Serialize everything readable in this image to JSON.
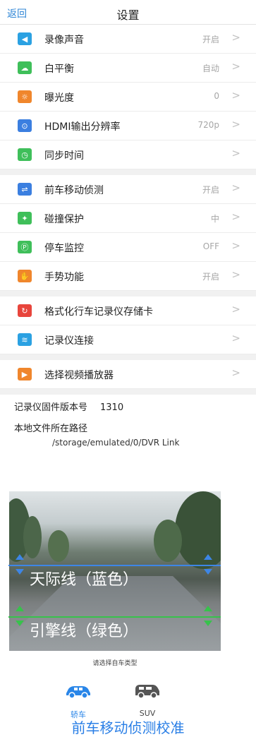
{
  "header": {
    "back_label": "返回",
    "title": "设置"
  },
  "settings": [
    {
      "label": "录像声音",
      "value": "开启",
      "icon": "speaker-icon",
      "color": "#2ba1e2"
    },
    {
      "label": "白平衡",
      "value": "自动",
      "icon": "white-balance-icon",
      "color": "#3fbf5a"
    },
    {
      "label": "曝光度",
      "value": "0",
      "icon": "exposure-icon",
      "color": "#f0862c"
    },
    {
      "label": "HDMI输出分辨率",
      "value": "720p",
      "icon": "hdmi-icon",
      "color": "#3b7fe0"
    },
    {
      "label": "同步时间",
      "value": "",
      "icon": "clock-icon",
      "color": "#3fbf5a"
    },
    {
      "label": "前车移动侦测",
      "value": "开启",
      "icon": "car-detect-icon",
      "color": "#3b7fe0"
    },
    {
      "label": "碰撞保护",
      "value": "中",
      "icon": "collision-icon",
      "color": "#3fbf5a"
    },
    {
      "label": "停车监控",
      "value": "OFF",
      "icon": "parking-icon",
      "color": "#3fbf5a"
    },
    {
      "label": "手势功能",
      "value": "开启",
      "icon": "gesture-icon",
      "color": "#f0862c"
    },
    {
      "label": "格式化行车记录仪存储卡",
      "value": "",
      "icon": "format-icon",
      "color": "#e8453c"
    },
    {
      "label": "记录仪连接",
      "value": "",
      "icon": "wifi-icon",
      "color": "#2ba1e2"
    },
    {
      "label": "选择视频播放器",
      "value": "",
      "icon": "player-icon",
      "color": "#f0862c"
    }
  ],
  "info": {
    "firmware_label": "记录仪固件版本号",
    "firmware_value": "1310",
    "path_label": "本地文件所在路径",
    "path_value": "/storage/emulated/0/DVR Link"
  },
  "calibration": {
    "horizon_label": "天际线（蓝色）",
    "engine_label": "引擎线（绿色）",
    "prompt": "请选择自车类型",
    "car_sedan": "轿车",
    "car_suv": "SUV",
    "title": "前车移动侦测校准"
  },
  "colors": {
    "accent": "#2f86d6",
    "horizon_line": "#3d86e6",
    "engine_line": "#37c24b"
  }
}
